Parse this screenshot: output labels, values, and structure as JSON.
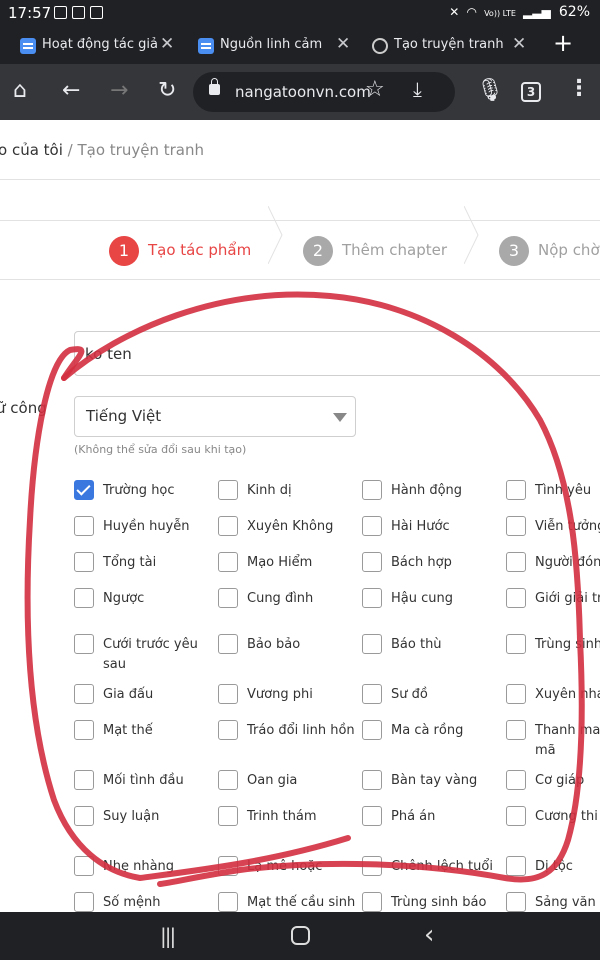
{
  "status_bar": {
    "time": "17:57",
    "battery": "62%",
    "network_label": "Vo)) LTE"
  },
  "tabs": [
    {
      "title": "Hoạt động tác giả",
      "icon": "app-icon"
    },
    {
      "title": "Nguồn linh cảm",
      "icon": "app-icon"
    },
    {
      "title": "Tạo truyện tranh",
      "icon": "globe-icon"
    }
  ],
  "toolbar": {
    "url": "nangatoonvn.com",
    "tab_count": "3"
  },
  "breadcrumb": {
    "home": "o của tôi",
    "separator": " / ",
    "current": "Tạo truyện tranh"
  },
  "steps": [
    {
      "number": "1",
      "label": "Tạo tác phẩm",
      "active": true
    },
    {
      "number": "2",
      "label": "Thêm chapter",
      "active": false
    },
    {
      "number": "3",
      "label": "Nộp chờ",
      "active": false
    }
  ],
  "form": {
    "title_value": "ko ten",
    "language_label": "ữ công",
    "language_value": "Tiếng Việt",
    "language_hint": "(Không thể sửa đổi sau khi tạo)"
  },
  "genres": [
    {
      "label": "Trường học",
      "checked": true
    },
    {
      "label": "Kinh dị",
      "checked": false
    },
    {
      "label": "Hành động",
      "checked": false
    },
    {
      "label": "Tình yêu",
      "checked": false
    },
    {
      "label": "Huyền huyễn",
      "checked": false
    },
    {
      "label": "Xuyên Không",
      "checked": false
    },
    {
      "label": "Hài Hước",
      "checked": false
    },
    {
      "label": "Viễn tưởng",
      "checked": false
    },
    {
      "label": "Tổng tài",
      "checked": false
    },
    {
      "label": "Mạo Hiểm",
      "checked": false
    },
    {
      "label": "Bách hợp",
      "checked": false
    },
    {
      "label": "Người đóng",
      "checked": false
    },
    {
      "label": "Ngược",
      "checked": false
    },
    {
      "label": "Cung đình",
      "checked": false
    },
    {
      "label": "Hậu cung",
      "checked": false
    },
    {
      "label": "Giới giải trí",
      "checked": false
    },
    {
      "label": "Cưới trước yêu\nsau",
      "checked": false
    },
    {
      "label": "Bảo bảo",
      "checked": false
    },
    {
      "label": "Báo thù",
      "checked": false
    },
    {
      "label": "Trùng sinh",
      "checked": false
    },
    {
      "label": "Gia đấu",
      "checked": false
    },
    {
      "label": "Vương phi",
      "checked": false
    },
    {
      "label": "Sư đồ",
      "checked": false
    },
    {
      "label": "Xuyên nhanh",
      "checked": false
    },
    {
      "label": "Mạt thế",
      "checked": false
    },
    {
      "label": "Tráo đổi linh hồn",
      "checked": false
    },
    {
      "label": "Ma cà rồng",
      "checked": false
    },
    {
      "label": "Thanh mai\nmã",
      "checked": false
    },
    {
      "label": "Mối tình đầu",
      "checked": false
    },
    {
      "label": "Oan gia",
      "checked": false
    },
    {
      "label": "Bàn tay vàng",
      "checked": false
    },
    {
      "label": "Cơ giáp",
      "checked": false
    },
    {
      "label": "Suy luận",
      "checked": false
    },
    {
      "label": "Trinh thám",
      "checked": false
    },
    {
      "label": "Phá án",
      "checked": false
    },
    {
      "label": "Cương thi",
      "checked": false
    },
    {
      "label": "Nhẹ nhàng",
      "checked": false
    },
    {
      "label": "Lạ mê hoặc",
      "checked": false
    },
    {
      "label": "Chênh lệch tuổi",
      "checked": false
    },
    {
      "label": "Dị tộc",
      "checked": false
    },
    {
      "label": "Số mệnh",
      "checked": false
    },
    {
      "label": "Mạt thế cầu sinh",
      "checked": false
    },
    {
      "label": "Trùng sinh báo",
      "checked": false
    },
    {
      "label": "Sảng văn",
      "checked": false
    }
  ],
  "colors": {
    "accent_red": "#e84545",
    "checkbox_blue": "#3a78e0",
    "annotation_red": "#d32f3f"
  },
  "icons": {
    "nav": [
      "home-icon",
      "back-icon",
      "forward-icon",
      "reload-icon",
      "lock-icon",
      "star-icon",
      "download-icon",
      "mic-icon",
      "menu-icon"
    ]
  }
}
